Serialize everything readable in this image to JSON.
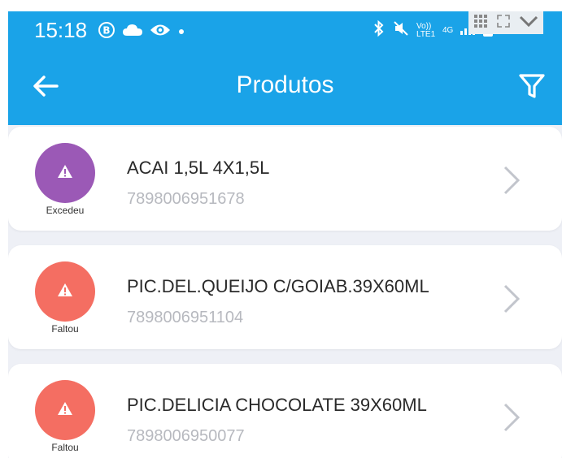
{
  "status_bar": {
    "time": "15:18",
    "left_icons": [
      "b-badge-icon",
      "cloud-icon",
      "eye-icon",
      "dot-icon"
    ],
    "right_icons": [
      "bluetooth-icon",
      "mute-icon",
      "volte-icon",
      "4g-icon",
      "signal-icon",
      "battery-icon"
    ],
    "volte_text": "Vo)) LTE1",
    "network_text": "4G"
  },
  "toolbar": {
    "back_icon": "arrow-left-icon",
    "title": "Produtos",
    "filter_icon": "filter-icon"
  },
  "colors": {
    "header": "#1aa3e8",
    "list_background": "#eef0f6",
    "excedeu": "#9b59b6",
    "faltou": "#f46e62",
    "code_text": "#b7b9bf"
  },
  "products": [
    {
      "status": "Excedeu",
      "status_icon": "warning-icon",
      "name": "ACAI 1,5L 4X1,5L",
      "code": "7898006951678"
    },
    {
      "status": "Faltou",
      "status_icon": "warning-icon",
      "name": "PIC.DEL.QUEIJO C/GOIAB.39X60ML",
      "code": "7898006951104"
    },
    {
      "status": "Faltou",
      "status_icon": "warning-icon",
      "name": "PIC.DELICIA CHOCOLATE 39X60ML",
      "code": "7898006950077"
    }
  ]
}
